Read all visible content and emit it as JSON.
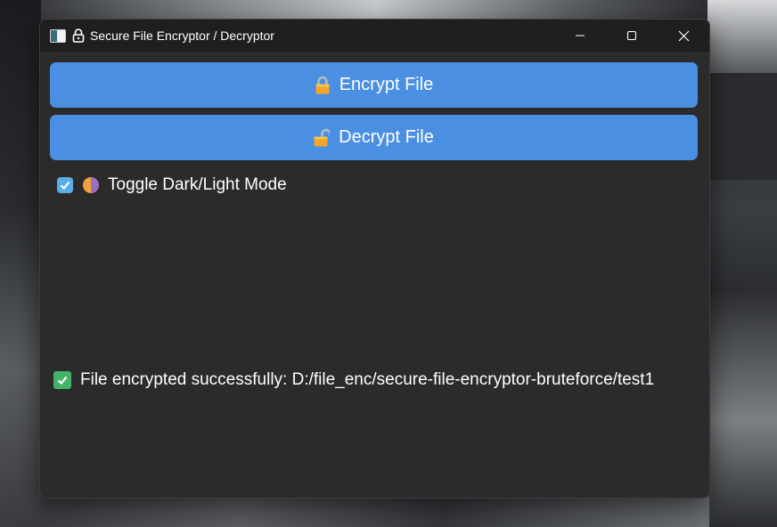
{
  "window": {
    "title": "Secure File Encryptor / Decryptor",
    "controls": [
      "minimize",
      "maximize",
      "close"
    ]
  },
  "buttons": {
    "encrypt_label": "Encrypt File",
    "encrypt_icon": "lock-icon",
    "decrypt_label": "Decrypt File",
    "decrypt_icon": "unlock-icon"
  },
  "theme_toggle": {
    "label": "Toggle Dark/Light Mode",
    "checked": true,
    "icon": "half-moon-icon"
  },
  "status": {
    "message": "File encrypted successfully: D:/file_enc/secure-file-encryptor-bruteforce/test1",
    "icon": "check-mark-icon"
  },
  "colors": {
    "button_bg": "#4a8fe2",
    "window_bg": "#2b2b2b",
    "titlebar_bg": "#1f1f1f",
    "checkbox": "#5aaee8",
    "success": "#43b36a"
  }
}
